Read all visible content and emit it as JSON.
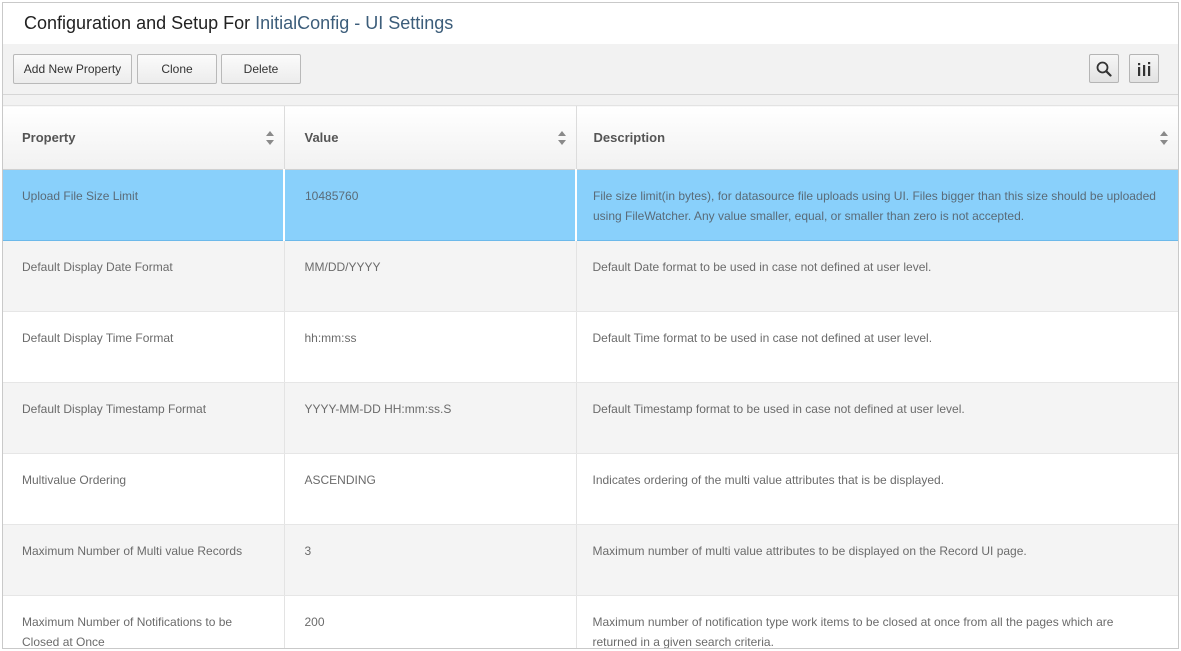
{
  "header": {
    "title_prefix": "Configuration and Setup For",
    "title_accent": "InitialConfig - UI Settings"
  },
  "toolbar": {
    "add_label": "Add New Property",
    "clone_label": "Clone",
    "delete_label": "Delete",
    "icons": [
      "search-icon",
      "columns-icon"
    ]
  },
  "table": {
    "columns": [
      "Property",
      "Value",
      "Description"
    ],
    "rows": [
      {
        "property": "Upload File Size Limit",
        "value": "10485760",
        "description": "File size limit(in bytes), for datasource file uploads using UI. Files bigger than this size should be uploaded using FileWatcher. Any value smaller, equal, or smaller than zero is not accepted."
      },
      {
        "property": "Default Display Date Format",
        "value": "MM/DD/YYYY",
        "description": "Default Date format to be used in case not defined at user level."
      },
      {
        "property": "Default Display Time Format",
        "value": "hh:mm:ss",
        "description": "Default Time format to be used in case not defined at user level."
      },
      {
        "property": "Default Display Timestamp Format",
        "value": "YYYY-MM-DD HH:mm:ss.S",
        "description": "Default Timestamp format to be used in case not defined at user level."
      },
      {
        "property": "Multivalue Ordering",
        "value": "ASCENDING",
        "description": "Indicates ordering of the multi value attributes that is be displayed."
      },
      {
        "property": "Maximum Number of Multi value Records",
        "value": "3",
        "description": "Maximum number of multi value attributes to be displayed on the Record UI page."
      },
      {
        "property": "Maximum Number of Notifications to be Closed at Once",
        "value": "200",
        "description": "Maximum number of notification type work items to be closed at once from all the pages which are returned in a given search criteria."
      }
    ],
    "selected_row": 0
  },
  "colors": {
    "selected_row": "#89d0fb",
    "title_accent": "#3c5d7a",
    "toolbar_bg": "#f2f2f2"
  }
}
